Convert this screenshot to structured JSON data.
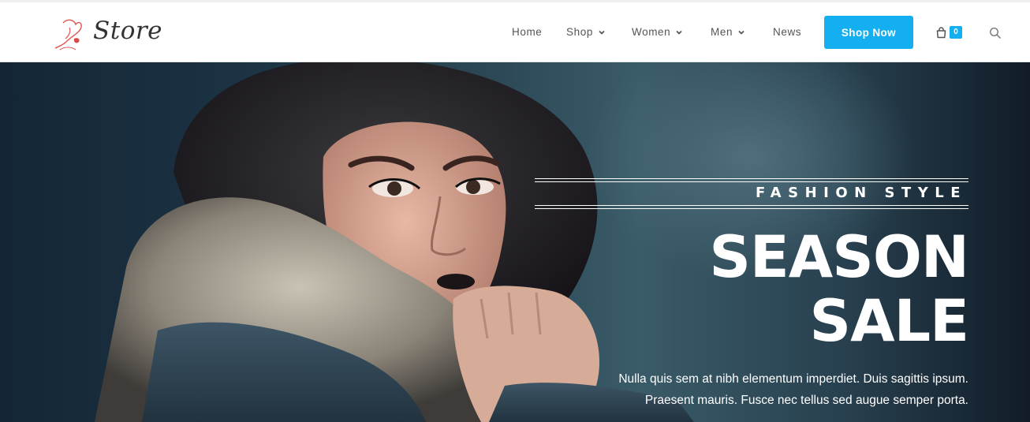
{
  "header": {
    "logo_text": "Store",
    "nav": [
      {
        "label": "Home",
        "has_dropdown": false
      },
      {
        "label": "Shop",
        "has_dropdown": true
      },
      {
        "label": "Women",
        "has_dropdown": true
      },
      {
        "label": "Men",
        "has_dropdown": true
      },
      {
        "label": "News",
        "has_dropdown": false
      }
    ],
    "cta_label": "Shop Now",
    "cart_count": "0",
    "icons": {
      "cart": "shopping-bag-icon",
      "search": "search-icon",
      "dropdown": "chevron-down-icon"
    }
  },
  "hero": {
    "eyebrow": "FASHION STYLE",
    "headline_line1": "SEASON",
    "headline_line2": "SALE",
    "description_line1": "Nulla quis sem at nibh elementum imperdiet. Duis sagittis ipsum.",
    "description_line2": "Praesent mauris. Fusce nec tellus sed augue semper porta."
  },
  "colors": {
    "accent": "#13aff0",
    "hero_text": "#ffffff",
    "nav_text": "#555555"
  }
}
